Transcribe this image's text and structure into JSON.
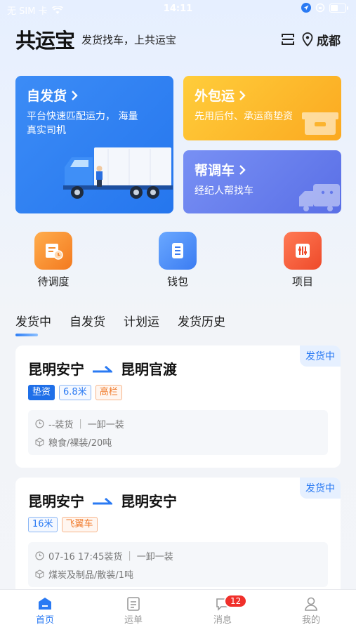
{
  "status_bar": {
    "carrier": "无 SIM 卡",
    "time": "14:11"
  },
  "header": {
    "logo": "共运宝",
    "slogan": "发货找车，上共运宝",
    "city": "成都"
  },
  "cards": [
    {
      "title": "自发货",
      "desc_line1": "平台快速匹配运力， 海量",
      "desc_line2": "真实司机"
    },
    {
      "title": "外包运",
      "desc": "先用后付、承运商垫资"
    },
    {
      "title": "帮调车",
      "desc": "经纪人帮找车"
    }
  ],
  "quick_actions": [
    {
      "label": "待调度"
    },
    {
      "label": "钱包"
    },
    {
      "label": "项目"
    }
  ],
  "tabs": [
    "发货中",
    "自发货",
    "计划运",
    "发货历史"
  ],
  "orders": [
    {
      "status": "发货中",
      "from": "昆明安宁",
      "to": "昆明官渡",
      "tags": [
        "垫资",
        "6.8米",
        "高栏"
      ],
      "loading": "--装货",
      "load_mode": "一卸一装",
      "cargo": "粮食/裸装/20吨"
    },
    {
      "status": "发货中",
      "from": "昆明安宁",
      "to": "昆明安宁",
      "tags": [
        "16米",
        "飞翼车"
      ],
      "loading": "07-16 17:45装货",
      "load_mode": "一卸一装",
      "cargo": "煤炭及制品/散装/1吨"
    }
  ],
  "bottom_nav": [
    {
      "label": "首页"
    },
    {
      "label": "运单"
    },
    {
      "label": "消息",
      "badge": "12"
    },
    {
      "label": "我的"
    }
  ],
  "colors": {
    "accent": "#2a7af3",
    "orange": "#fba920",
    "purple": "#6a7ff0",
    "badge": "#f0302b"
  }
}
